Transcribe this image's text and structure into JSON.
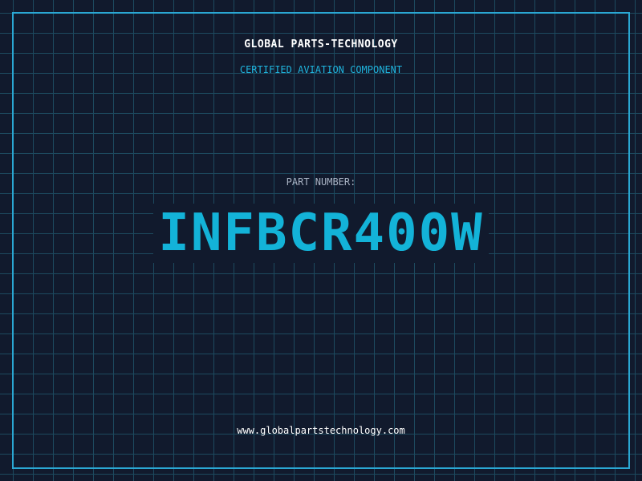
{
  "header": {
    "company": "GLOBAL PARTS-TECHNOLOGY",
    "tagline": "CERTIFIED AVIATION COMPONENT"
  },
  "part": {
    "label": "PART NUMBER:",
    "number": "INFBCR400W"
  },
  "footer": {
    "website": "www.globalpartstechnology.com"
  },
  "colors": {
    "background": "#111a2d",
    "grid": "#1d4a5f",
    "accent": "#13b3d8",
    "frame": "#2aa7d3",
    "text_primary": "#ffffff",
    "text_muted": "#a9b3c4"
  }
}
